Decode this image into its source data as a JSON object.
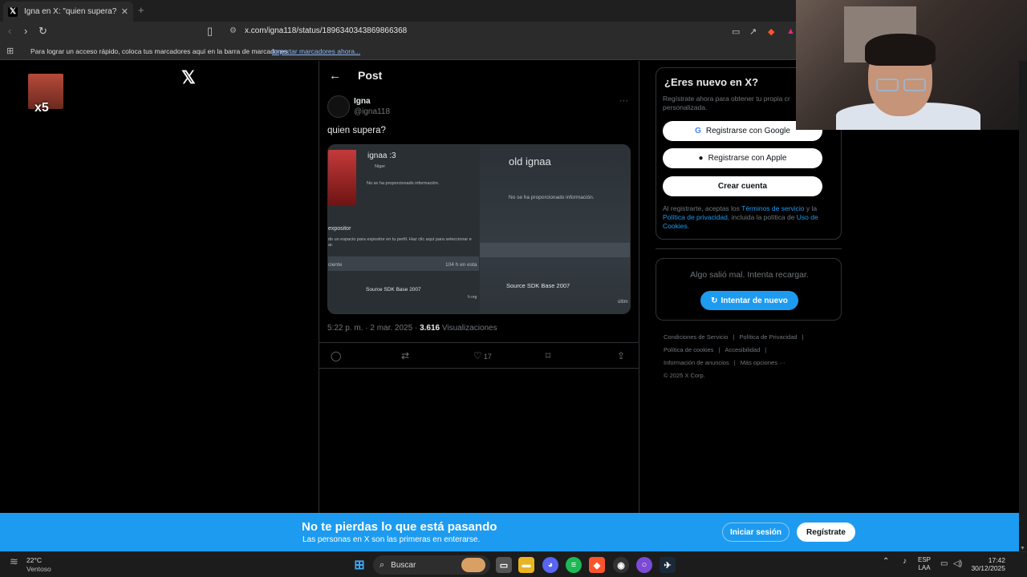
{
  "browser": {
    "tab_title": "Igna en X: \"quien supera? https:...",
    "tab_close": "✕",
    "new_tab": "+",
    "url": "x.com/igna118/status/1896340343869866368",
    "bookmarks_message": "Para lograr un acceso rápido, coloca tus marcadores aquí en la barra de marcadores.",
    "bookmarks_import": "Importar marcadores ahora..."
  },
  "left_widget": {
    "label": "x5"
  },
  "post": {
    "header": "Post",
    "display_name": "Igna",
    "handle": "@igna118",
    "text": "quien supera?",
    "time": "5:22 p. m. · 2 mar. 2025 · ",
    "views": "3.616",
    "views_label": " Visualizaciones",
    "likes": "17",
    "images": {
      "left": {
        "name": "ignaa :3",
        "flag": "Niger",
        "info": "No se ha proporcionado información.",
        "section": "expositor",
        "section_desc": "do un espacio para expositor en tu perfil. Haz clic aquí para seleccionar e",
        "section_desc2": "ar.",
        "row_left": "ciente",
        "row_right": "104 h en esta",
        "game": "Source SDK Base 2007",
        "game_sub": "h reg"
      },
      "right": {
        "name": "old ignaa",
        "info": "No se ha proporcionado información.",
        "game": "Source SDK Base 2007",
        "game_sub": "últim"
      }
    }
  },
  "signup": {
    "title": "¿Eres nuevo en X?",
    "subtitle": "Regístrate ahora para obtener tu propia cr personalizada.",
    "google": "Registrarse con Google",
    "apple": "Registrarse con Apple",
    "create": "Crear cuenta",
    "legal_prefix": "Al registrarte, aceptas los ",
    "terms": "Términos de servicio",
    "legal_and": " y la ",
    "privacy": "Política de privacidad",
    "legal_mid": ", incluida la política de ",
    "cookies": "Uso de Cookies",
    "legal_end": "."
  },
  "error_card": {
    "message": "Algo salió mal. Intenta recargar.",
    "retry": "Intentar de nuevo"
  },
  "footer_links": {
    "terms": "Condiciones de Servicio",
    "privacy": "Política de Privacidad",
    "cookies": "Política de cookies",
    "accessibility": "Accesibilidad",
    "ads": "Información de anuncios",
    "more": "Más opciones ···",
    "copyright": "© 2025 X Corp."
  },
  "banner": {
    "headline": "No te pierdas lo que está pasando",
    "sub": "Las personas en X son las primeras en enterarse.",
    "login": "Iniciar sesión",
    "register": "Regístrate"
  },
  "taskbar": {
    "temp": "22°C",
    "condition": "Ventoso",
    "search": "Buscar",
    "lang_top": "ESP",
    "lang_bottom": "LAA",
    "time": "17:42",
    "date": "30/12/2025"
  },
  "colors": {
    "x_blue": "#1d9bf0",
    "border": "#2f3336",
    "muted": "#71767b"
  }
}
